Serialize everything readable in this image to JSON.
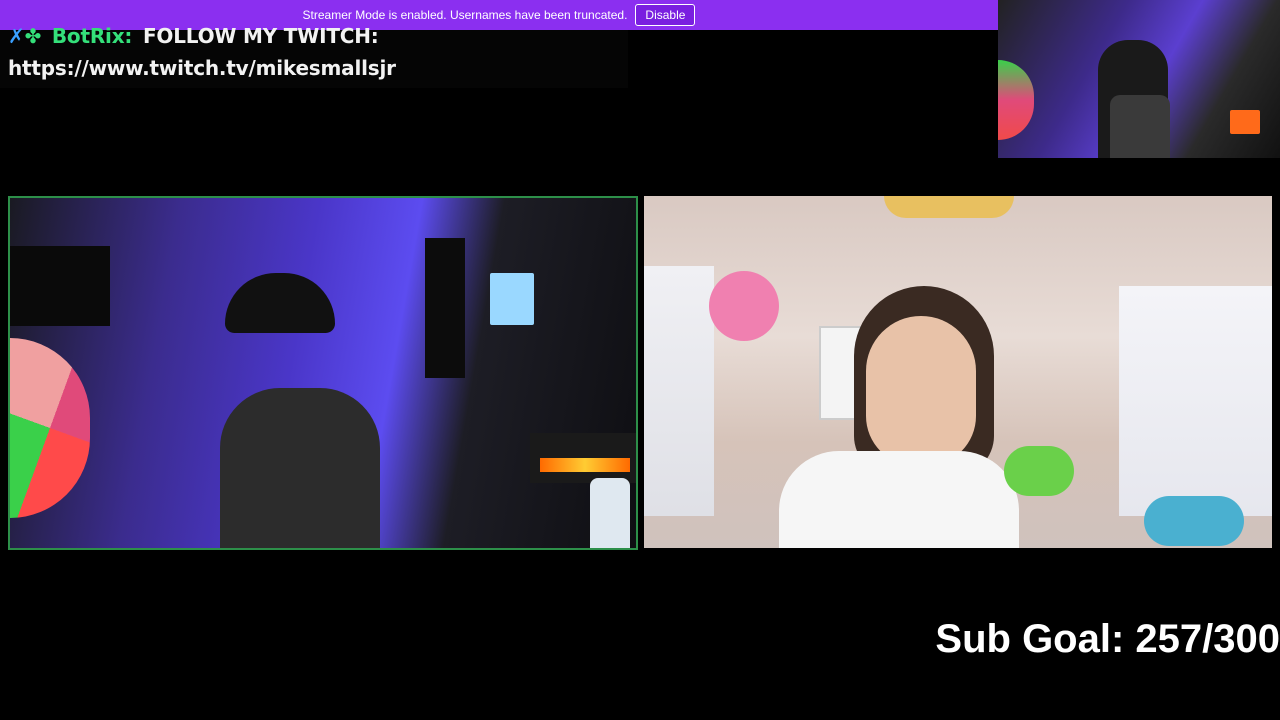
{
  "banner": {
    "message": "Streamer Mode is enabled. Usernames have been truncated.",
    "disable_label": "Disable",
    "color": "#8b2ff0"
  },
  "chat": {
    "badge_icons": [
      "sword-icon",
      "gem-icon"
    ],
    "username": "BotRix:",
    "message": "FOLLOW MY TWITCH:",
    "link": "https://www.twitch.tv/mikesmallsjr"
  },
  "overlay": {
    "sub_goal": "Sub Goal: 257/300"
  },
  "colors": {
    "accent_green": "#34e07a",
    "cam_border": "#2d8f49"
  }
}
